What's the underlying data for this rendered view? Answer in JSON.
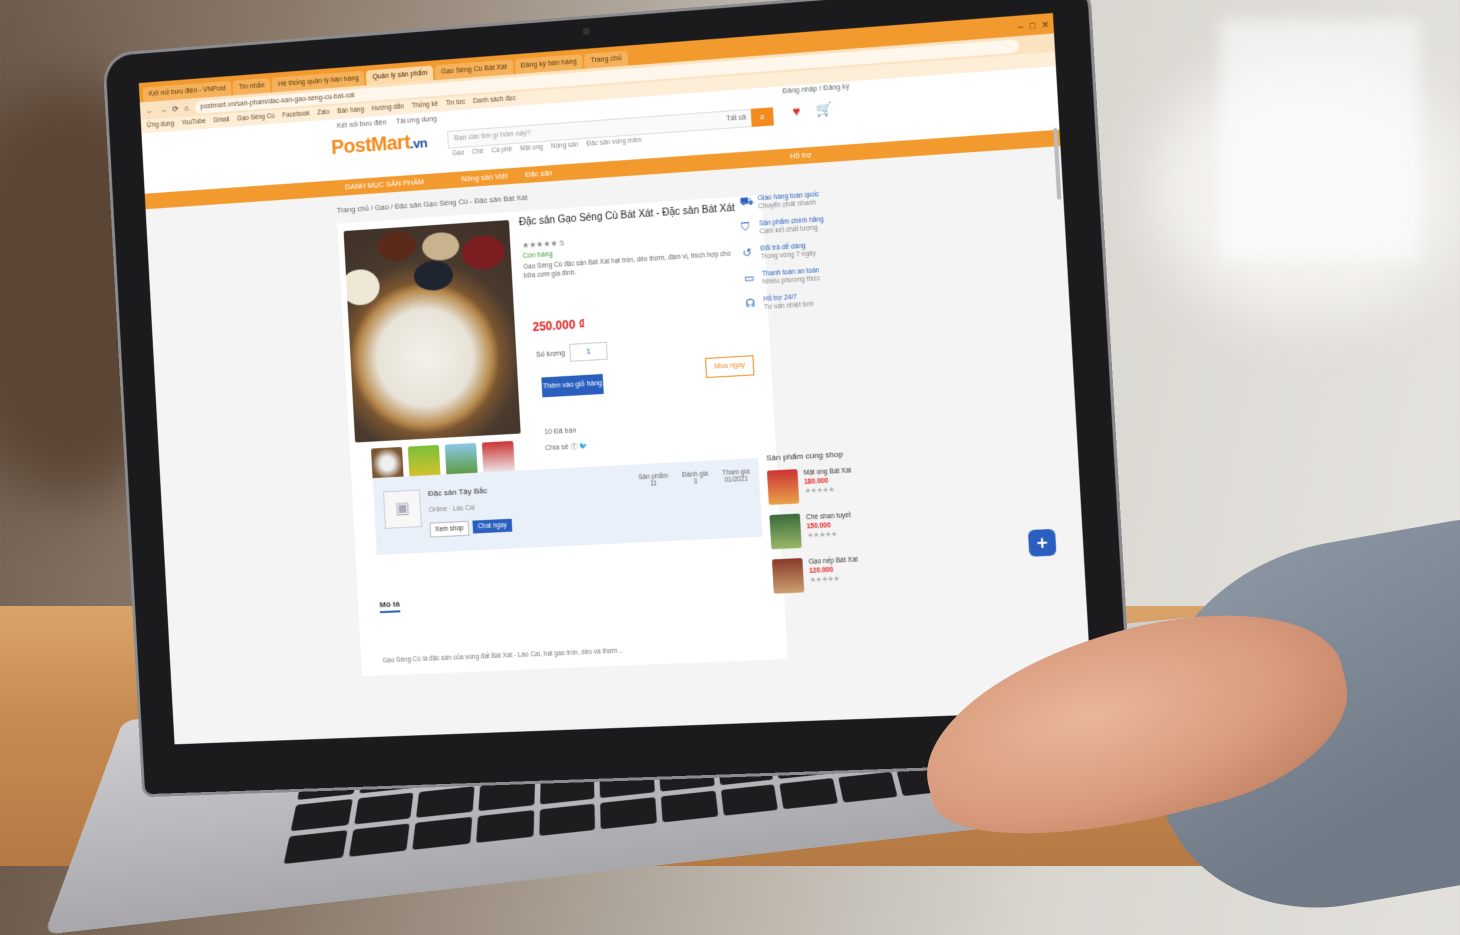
{
  "browser": {
    "tabs": [
      "Kết nối bưu điện - VNPost",
      "Tin nhắn",
      "Hệ thống quản lý bán hàng",
      "Quản lý sản phẩm",
      "Gạo Séng Cù Bát Xát",
      "Đăng ký bán hàng",
      "Trang chủ"
    ],
    "active_tab_index": 3,
    "url": "postmart.vn/san-pham/dac-san-gao-seng-cu-bat-xat",
    "bookmarks": [
      "Ứng dụng",
      "YouTube",
      "Gmail",
      "Gạo Séng Cù",
      "Facebook",
      "Zalo",
      "Bán hàng",
      "Hướng dẫn",
      "Thống kê",
      "Tin tức",
      "Danh sách đọc"
    ],
    "window_controls": [
      "–",
      "□",
      "✕"
    ]
  },
  "site": {
    "logo_main": "PostMart",
    "logo_suffix": ".vn",
    "top_links": [
      "Kết nối bưu điện",
      "Tải ứng dụng"
    ],
    "support": "Đăng nhập / Đăng ký",
    "search_placeholder": "Bạn cần tìm gì hôm nay?",
    "search_category": "Tất cả",
    "search_suggestions": [
      "Gạo",
      "Chè",
      "Cà phê",
      "Mật ong",
      "Nông sản",
      "Đặc sản vùng miền"
    ],
    "nav": {
      "categories": "DANH MỤC SẢN PHẨM",
      "item2": "Nông sản Việt",
      "item3": "Đặc sản",
      "item4": "Hỗ trợ"
    },
    "breadcrumb": "Trang chủ / Gạo / Đặc sản Gạo Séng Cù - Đặc sản Bát Xát"
  },
  "product": {
    "title": "Đặc sản Gạo Séng Cù Bát Xát - Đặc sản Bát Xát",
    "rating": "★★★★★ 5",
    "stock": "Còn hàng",
    "description": "Gạo Séng Cù đặc sản Bát Xát hạt tròn, dẻo thơm, đậm vị, thích hợp cho bữa cơm gia đình.",
    "price": "250.000 ₫",
    "qty_label": "Số lượng",
    "qty": "1",
    "add_to_cart": "Thêm vào giỏ hàng",
    "buy_now": "Mua ngay",
    "sold": "10 Đã bán",
    "share": "Chia sẻ"
  },
  "features": [
    {
      "title": "Giao hàng toàn quốc",
      "sub": "Chuyển phát nhanh"
    },
    {
      "title": "Sản phẩm chính hãng",
      "sub": "Cam kết chất lượng"
    },
    {
      "title": "Đổi trả dễ dàng",
      "sub": "Trong vòng 7 ngày"
    },
    {
      "title": "Thanh toán an toàn",
      "sub": "Nhiều phương thức"
    },
    {
      "title": "Hỗ trợ 24/7",
      "sub": "Tư vấn nhiệt tình"
    }
  ],
  "shop": {
    "name": "Đặc sản Tây Bắc",
    "sub": "Online · Lào Cai",
    "btn_view": "Xem shop",
    "btn_chat": "Chat ngay",
    "stats": [
      {
        "label": "Sản phẩm",
        "value": "11"
      },
      {
        "label": "Đánh giá",
        "value": "3"
      },
      {
        "label": "Tham gia",
        "value": "01/2021"
      }
    ]
  },
  "related": {
    "title": "Sản phẩm cùng shop",
    "items": [
      {
        "name": "Mật ong Bát Xát",
        "price": "180.000",
        "stars": "★★★★★"
      },
      {
        "name": "Chè shan tuyết",
        "price": "150.000",
        "stars": "★★★★★"
      },
      {
        "name": "Gạo nếp Bát Xát",
        "price": "120.000",
        "stars": "★★★★★"
      }
    ]
  },
  "description_tab": "Mô tả",
  "description_text": "Gạo Séng Cù là đặc sản của vùng đất Bát Xát - Lào Cai, hạt gạo tròn, dẻo và thơm...",
  "colors": {
    "brand_orange": "#f29a2e",
    "brand_blue": "#2a5fbf",
    "price_red": "#e02020"
  }
}
